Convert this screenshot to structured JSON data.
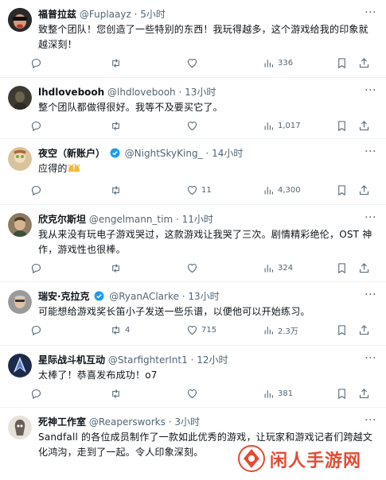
{
  "tweets": [
    {
      "name": "福普拉兹",
      "verified": false,
      "handle": "@Fuplaayz",
      "time": "5小时",
      "text": "致整个团队！您创造了一些特别的东西！我玩得越多，这个游戏给我的印象就越深刻！",
      "replies": "",
      "retweets": "",
      "likes": "",
      "views": "336",
      "avatar_color": "#2b2b2b"
    },
    {
      "name": "lhdlovebooh",
      "verified": false,
      "handle": "@lhdlovebooh",
      "time": "13小时",
      "text": "整个团队都做得很好。我等不及要买它了。",
      "replies": "",
      "retweets": "",
      "likes": "",
      "views": "1,017",
      "avatar_color": "#4a4538"
    },
    {
      "name": "夜空（新账户）",
      "verified": true,
      "handle": "@NightSkyKing_",
      "time": "14小时",
      "text": "应得的",
      "replies": "",
      "retweets": "",
      "likes": "11",
      "views": "4,300",
      "avatar_color": "#c9b38a"
    },
    {
      "name": "欣克尔斯坦",
      "verified": false,
      "handle": "@engelmann_tim",
      "time": "11小时",
      "text": "我从来没有玩电子游戏哭过，这款游戏让我哭了三次。剧情精彩绝伦，OST 神作，游戏性也很棒。",
      "replies": "",
      "retweets": "",
      "likes": "",
      "views": "324",
      "avatar_color": "#7a6a55"
    },
    {
      "name": "瑞安·克拉克",
      "verified": true,
      "handle": "@RyanAClarke",
      "time": "13小时",
      "text": "可能想给游戏奖长笛小子发送一些乐谱，以便他可以开始练习。",
      "replies": "",
      "retweets": "4",
      "likes": "715",
      "views": "2.3万",
      "avatar_color": "#8a8a8a"
    },
    {
      "name": "星际战斗机互动",
      "verified": false,
      "handle": "@StarfighterInt1",
      "time": "12小时",
      "text": "太棒了！恭喜发布成功！o7",
      "replies": "",
      "retweets": "",
      "likes": "",
      "views": "381",
      "avatar_color": "#1d2a4a"
    },
    {
      "name": "死神工作室",
      "verified": false,
      "handle": "@Reapersworks",
      "time": "3小时",
      "text": "Sandfall 的各位成员制作了一款如此优秀的游戏，让玩家和游戏记者们跨越文化鸿沟，走到了一起。令人印象深刻。",
      "replies": "",
      "retweets": "",
      "likes": "",
      "views": "",
      "avatar_color": "#d8d4cc"
    }
  ],
  "separator": "·",
  "more_label": "···",
  "watermark": {
    "text": "闲人手游网",
    "color": "#e34b32"
  },
  "icons": {
    "reply": "reply-icon",
    "retweet": "retweet-icon",
    "like": "heart-icon",
    "views": "views-icon",
    "bookmark": "bookmark-icon",
    "share": "share-icon",
    "verified": "verified-badge-icon"
  },
  "colors": {
    "verified": "#1d9bf0",
    "muted": "#536471",
    "text": "#0f1419"
  }
}
